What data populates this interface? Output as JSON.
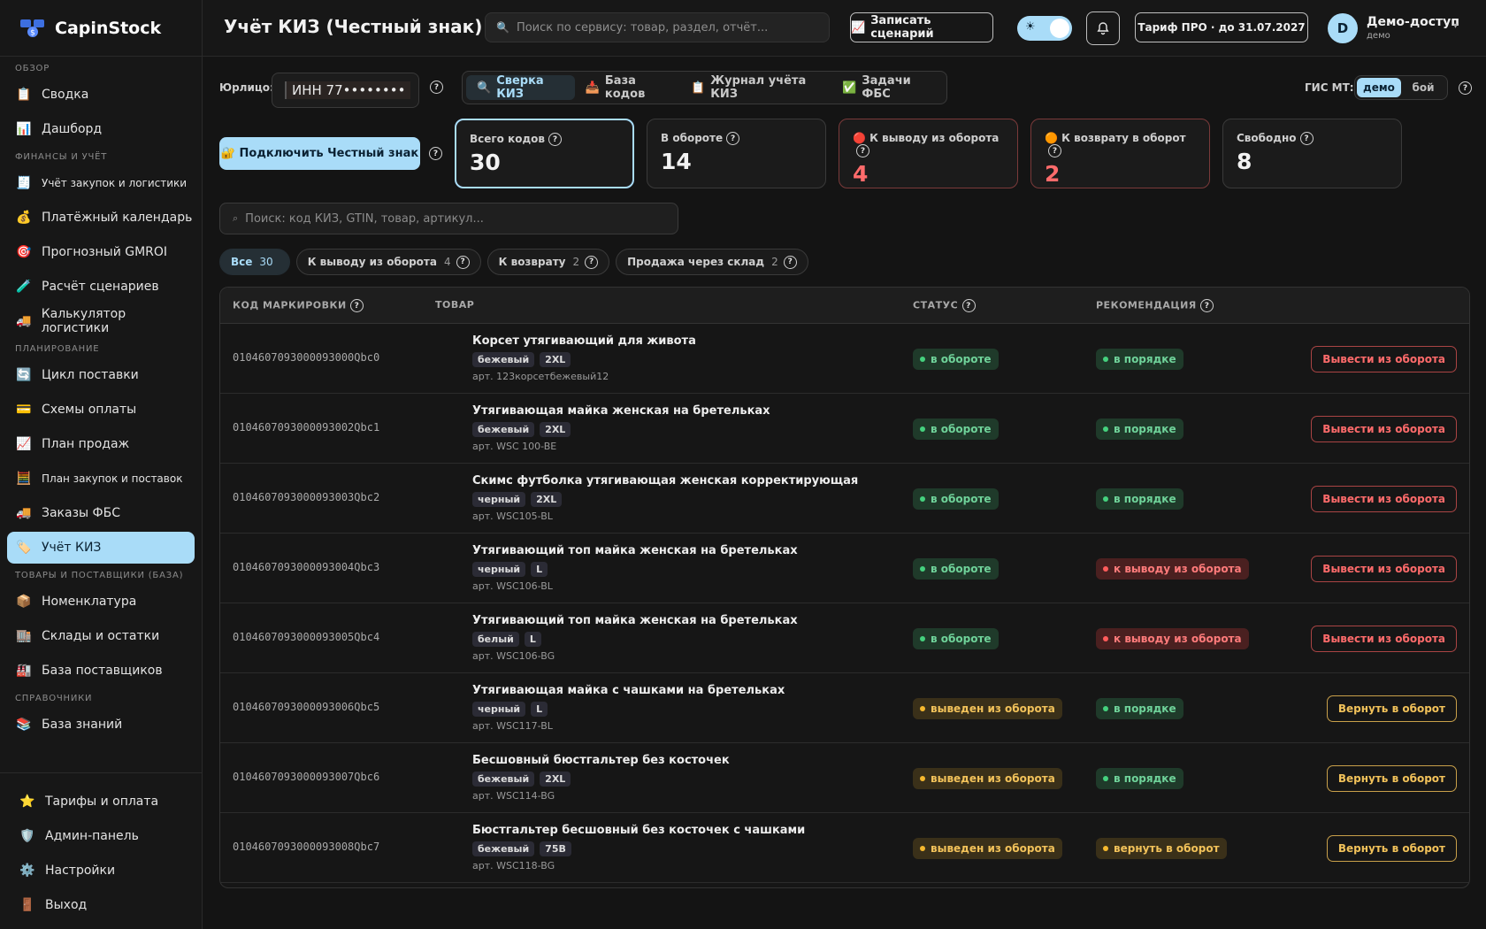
{
  "app": {
    "name": "CapinStock"
  },
  "sidebar": {
    "sections": [
      {
        "title": "ОБЗОР",
        "items": [
          {
            "icon": "📋",
            "label": "Сводка"
          },
          {
            "icon": "📊",
            "label": "Дашборд"
          }
        ]
      },
      {
        "title": "ФИНАНСЫ И УЧЁТ",
        "items": [
          {
            "icon": "🧾",
            "label": "Учёт закупок и логистики",
            "small": true
          },
          {
            "icon": "💰",
            "label": "Платёжный календарь"
          },
          {
            "icon": "🎯",
            "label": "Прогнозный GMROI"
          },
          {
            "icon": "🧪",
            "label": "Расчёт сценариев"
          },
          {
            "icon": "🚚",
            "label": "Калькулятор логистики"
          }
        ]
      },
      {
        "title": "ПЛАНИРОВАНИЕ",
        "items": [
          {
            "icon": "🔄",
            "label": "Цикл поставки"
          },
          {
            "icon": "💳",
            "label": "Схемы оплаты"
          },
          {
            "icon": "📈",
            "label": "План продаж"
          },
          {
            "icon": "🧮",
            "label": "План закупок и поставок",
            "small": true
          },
          {
            "icon": "🚚",
            "label": "Заказы ФБС"
          },
          {
            "icon": "🏷️",
            "label": "Учёт КИЗ",
            "active": true
          }
        ]
      },
      {
        "title": "ТОВАРЫ И ПОСТАВЩИКИ (БАЗА)",
        "items": [
          {
            "icon": "📦",
            "label": "Номенклатура"
          },
          {
            "icon": "🏬",
            "label": "Склады и остатки"
          },
          {
            "icon": "🏭",
            "label": "База поставщиков"
          }
        ]
      },
      {
        "title": "СПРАВОЧНИКИ",
        "items": [
          {
            "icon": "📚",
            "label": "База знаний"
          }
        ]
      }
    ],
    "bottom": [
      {
        "icon": "⭐",
        "label": "Тарифы и оплата"
      },
      {
        "icon": "🛡️",
        "label": "Админ-панель"
      },
      {
        "icon": "⚙️",
        "label": "Настройки"
      },
      {
        "icon": "🚪",
        "label": "Выход"
      }
    ]
  },
  "header": {
    "title": "Учёт КИЗ (Честный знак)",
    "search_placeholder": "Поиск по сервису: товар, раздел, отчёт...",
    "record_label": "Записать сценарий",
    "tariff_label": "Тариф ПРО · до 31.07.2027",
    "user_initial": "D",
    "user_name": "Демо-доступ",
    "user_role": "демо"
  },
  "toolbar": {
    "entity_label": "Юрлицо:",
    "entity_value": "ИНН 77••••••••",
    "tabs": [
      {
        "icon": "🔍",
        "label": "Сверка КИЗ",
        "active": true
      },
      {
        "icon": "📥",
        "label": "База кодов"
      },
      {
        "icon": "📋",
        "label": "Журнал учёта КИЗ"
      },
      {
        "icon": "✅",
        "label": "Задачи ФБС"
      }
    ],
    "gis_label": "ГИС МТ:",
    "gis_options": [
      "демо",
      "бой"
    ],
    "gis_selected": "демо",
    "connect_label": "🔐 Подключить Честный знак"
  },
  "stats": [
    {
      "label": "Всего кодов",
      "value": "30",
      "selected": true
    },
    {
      "label": "В обороте",
      "value": "14"
    },
    {
      "label": "🔴 К выводу из оборота",
      "value": "4",
      "warn": true
    },
    {
      "label": "🟠 К возврату в оборот",
      "value": "2",
      "warn": true
    },
    {
      "label": "Свободно",
      "value": "8"
    }
  ],
  "filter": {
    "search_placeholder": "Поиск: код КИЗ, GTIN, товар, артикул...",
    "chips": [
      {
        "label": "Все",
        "count": "30",
        "active": true
      },
      {
        "label": "К выводу из оборота",
        "count": "4"
      },
      {
        "label": "К возврату",
        "count": "2"
      },
      {
        "label": "Продажа через склад",
        "count": "2"
      }
    ]
  },
  "table": {
    "headers": {
      "code": "КОД МАРКИРОВКИ",
      "product": "ТОВАР",
      "status": "СТАТУС",
      "recommendation": "РЕКОМЕНДАЦИЯ"
    },
    "rows": [
      {
        "code": "0104607093000093000Qbc0",
        "name": "Корсет утягивающий для живота",
        "tags": [
          "бежевый",
          "2XL"
        ],
        "article": "арт. 123корсетбежевый12",
        "status": "в обороте",
        "status_type": "green",
        "rec": "в порядке",
        "rec_type": "green",
        "action": "Вывести из оборота",
        "action_type": "red"
      },
      {
        "code": "0104607093000093002Qbc1",
        "name": "Утягивающая майка женская на бретельках",
        "tags": [
          "бежевый",
          "2XL"
        ],
        "article": "арт. WSC 100-BE",
        "status": "в обороте",
        "status_type": "green",
        "rec": "в порядке",
        "rec_type": "green",
        "action": "Вывести из оборота",
        "action_type": "red"
      },
      {
        "code": "0104607093000093003Qbc2",
        "name": "Скимс футболка утягивающая женская корректирующая",
        "tags": [
          "черный",
          "2XL"
        ],
        "article": "арт. WSC105-BL",
        "status": "в обороте",
        "status_type": "green",
        "rec": "в порядке",
        "rec_type": "green",
        "action": "Вывести из оборота",
        "action_type": "red"
      },
      {
        "code": "0104607093000093004Qbc3",
        "name": "Утягивающий топ майка женская на бретельках",
        "tags": [
          "черный",
          "L"
        ],
        "article": "арт. WSC106-BL",
        "status": "в обороте",
        "status_type": "green",
        "rec": "к выводу из оборота",
        "rec_type": "red",
        "action": "Вывести из оборота",
        "action_type": "red"
      },
      {
        "code": "0104607093000093005Qbc4",
        "name": "Утягивающий топ майка женская на бретельках",
        "tags": [
          "белый",
          "L"
        ],
        "article": "арт. WSC106-BG",
        "status": "в обороте",
        "status_type": "green",
        "rec": "к выводу из оборота",
        "rec_type": "red",
        "action": "Вывести из оборота",
        "action_type": "red"
      },
      {
        "code": "0104607093000093006Qbc5",
        "name": "Утягивающая майка с чашками на бретельках",
        "tags": [
          "черный",
          "L"
        ],
        "article": "арт. WSC117-BL",
        "status": "выведен из оборота",
        "status_type": "yellow",
        "rec": "в порядке",
        "rec_type": "green",
        "action": "Вернуть в оборот",
        "action_type": "yel"
      },
      {
        "code": "0104607093000093007Qbc6",
        "name": "Бесшовный бюстгальтер без косточек",
        "tags": [
          "бежевый",
          "2XL"
        ],
        "article": "арт. WSC114-BG",
        "status": "выведен из оборота",
        "status_type": "yellow",
        "rec": "в порядке",
        "rec_type": "green",
        "action": "Вернуть в оборот",
        "action_type": "yel"
      },
      {
        "code": "0104607093000093008Qbc7",
        "name": "Бюстгальтер бесшовный без косточек с чашками",
        "tags": [
          "бежевый",
          "75B"
        ],
        "article": "арт. WSC118-BG",
        "status": "выведен из оборота",
        "status_type": "yellow",
        "rec": "вернуть в оборот",
        "rec_type": "yellow",
        "action": "Вернуть в оборот",
        "action_type": "yel"
      }
    ]
  }
}
